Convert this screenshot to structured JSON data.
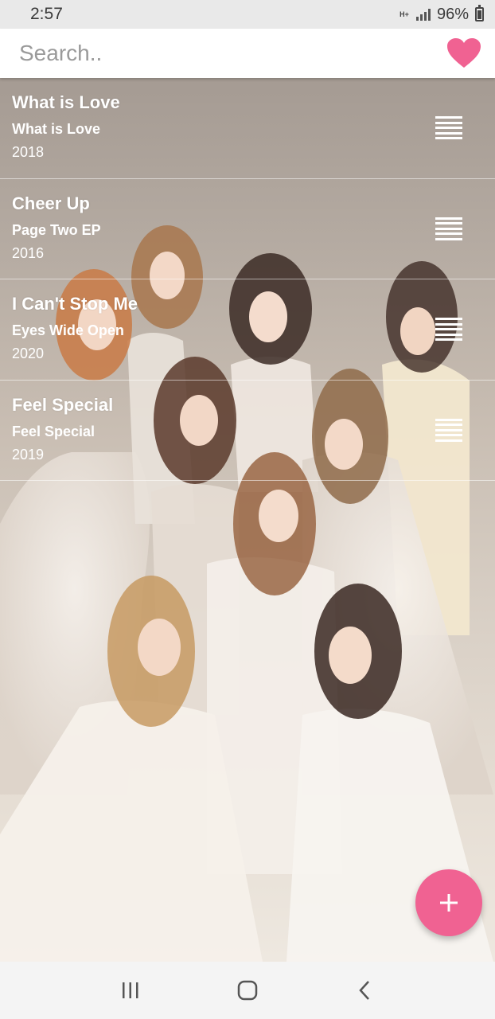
{
  "status_bar": {
    "time": "2:57",
    "network_type": "H+",
    "battery_percent": "96%",
    "icons": [
      "network-type-icon",
      "signal-icon",
      "battery-icon"
    ]
  },
  "search": {
    "placeholder": "Search..",
    "favorite_icon": "heart-icon",
    "favorite_color": "#f06292"
  },
  "songs": [
    {
      "title": "What is Love",
      "album": "What is Love",
      "year": "2018"
    },
    {
      "title": "Cheer Up",
      "album": "Page Two EP",
      "year": "2016"
    },
    {
      "title": "I Can't Stop Me",
      "album": "Eyes Wide Open",
      "year": "2020"
    },
    {
      "title": "Feel Special",
      "album": "Feel Special",
      "year": "2019"
    }
  ],
  "fab": {
    "icon": "plus-icon",
    "color": "#f06292"
  },
  "nav": {
    "icons": [
      "recents-icon",
      "home-icon",
      "back-icon"
    ]
  }
}
